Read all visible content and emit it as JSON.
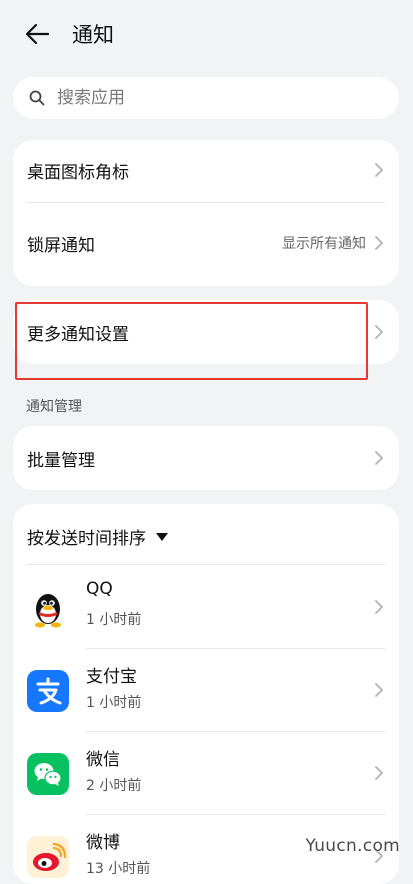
{
  "header": {
    "title": "通知"
  },
  "search": {
    "placeholder": "搜索应用"
  },
  "settings": {
    "badge_label": "桌面图标角标",
    "lockscreen_label": "锁屏通知",
    "lockscreen_value": "显示所有通知",
    "more_label": "更多通知设置"
  },
  "section": {
    "title": "通知管理"
  },
  "batch": {
    "label": "批量管理"
  },
  "sort": {
    "label": "按发送时间排序"
  },
  "apps": [
    {
      "name": "QQ",
      "time": "1 小时前",
      "icon": "qq-icon"
    },
    {
      "name": "支付宝",
      "time": "1 小时前",
      "icon": "alipay-icon"
    },
    {
      "name": "微信",
      "time": "2 小时前",
      "icon": "wechat-icon"
    },
    {
      "name": "微博",
      "time": "13 小时前",
      "icon": "weibo-icon"
    }
  ],
  "watermark": "Yuucn.com",
  "colors": {
    "highlight": "#e53935",
    "alipay": "#1677ff",
    "wechat": "#07c160",
    "background": "#f1f3f5"
  }
}
